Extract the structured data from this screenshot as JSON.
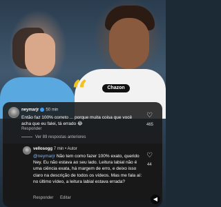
{
  "photo": {
    "sponsor": "Chazon",
    "quote_glyph": "“"
  },
  "comment1": {
    "username": "neymarjr",
    "time": "50 min",
    "text": "Então faz 100% correto ... porque muita coisa que você acha que eu falei, tá errado 😂",
    "reply_label": "Responder",
    "likes": "465"
  },
  "view_more": "Ver 89 respostas anteriores",
  "comment2": {
    "username": "vellosogg",
    "time": "7 min",
    "author_tag": "Autor",
    "mention": "@neymarjr",
    "text": "Não tem como fazer 100% exato, querido Ney. Eu não estava ao seu lado. Leitura labial não é uma ciência exata, há margem de erro, e deixo isso claro na descrição de todos os vídeos. Mas me fala aí: no último vídeo, a leitura labial estava errada?",
    "reply_label": "Responder",
    "edit_label": "Editar",
    "likes": "44"
  },
  "icons": {
    "heart": "heart-icon",
    "verified": "verified-badge-icon",
    "speaker": "speaker-icon"
  },
  "colors": {
    "quote": "#f2c21b",
    "verified": "#3b9cf5",
    "mention": "#7fb6ff"
  }
}
